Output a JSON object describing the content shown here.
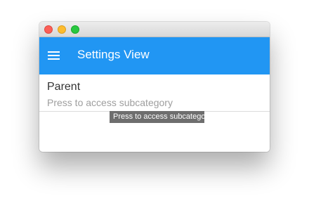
{
  "window": {
    "traffic_lights": [
      "close",
      "minimize",
      "maximize"
    ]
  },
  "appbar": {
    "menu_icon": "hamburger-menu-icon",
    "title": "Settings View",
    "color": "#2196f3"
  },
  "list": {
    "items": [
      {
        "title": "Parent",
        "subtitle": "Press to access subcategory"
      }
    ]
  },
  "tooltip": {
    "text": "Press to access subcategory"
  }
}
